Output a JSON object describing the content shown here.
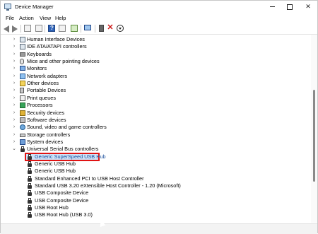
{
  "window": {
    "title": "Device Manager",
    "minimize_icon": "minimize-icon",
    "maximize_icon": "maximize-icon",
    "close_label": "✕"
  },
  "menu": {
    "items": [
      "File",
      "Action",
      "View",
      "Help"
    ]
  },
  "toolbar": {
    "icons": [
      "back-arrow-icon",
      "forward-arrow-icon",
      "show-hide-console-tree-icon",
      "properties-icon",
      "help-icon",
      "update-driver-icon",
      "scan-hardware-icon",
      "uninstall-device-icon",
      "remove-device-icon",
      "disable-device-icon"
    ],
    "remove_glyph": "✕"
  },
  "tree": {
    "categories": [
      {
        "label": "Human Interface Devices",
        "icon": "hid-icon"
      },
      {
        "label": "IDE ATA/ATAPI controllers",
        "icon": "ide-controller-icon"
      },
      {
        "label": "Keyboards",
        "icon": "keyboard-icon"
      },
      {
        "label": "Mice and other pointing devices",
        "icon": "mouse-icon"
      },
      {
        "label": "Monitors",
        "icon": "monitor-icon"
      },
      {
        "label": "Network adapters",
        "icon": "network-adapter-icon"
      },
      {
        "label": "Other devices",
        "icon": "unknown-device-icon"
      },
      {
        "label": "Portable Devices",
        "icon": "portable-device-icon"
      },
      {
        "label": "Print queues",
        "icon": "printer-icon"
      },
      {
        "label": "Processors",
        "icon": "processor-icon"
      },
      {
        "label": "Security devices",
        "icon": "security-device-icon"
      },
      {
        "label": "Software devices",
        "icon": "software-device-icon"
      },
      {
        "label": "Sound, video and game controllers",
        "icon": "sound-icon"
      },
      {
        "label": "Storage controllers",
        "icon": "storage-controller-icon"
      },
      {
        "label": "System devices",
        "icon": "system-device-icon"
      }
    ],
    "expanded_category": {
      "label": "Universal Serial Bus controllers",
      "icon": "usb-controller-icon",
      "children": [
        "Generic SuperSpeed USB Hub",
        "Generic USB Hub",
        "Generic USB Hub",
        "Standard Enhanced PCI to USB Host Controller",
        "Standard USB 3.20 eXtensible Host Controller - 1.20 (Microsoft)",
        "USB Composite Device",
        "USB Composite Device",
        "USB Root Hub",
        "USB Root Hub (USB 3.0)"
      ],
      "selected_child": "Generic SuperSpeed USB Hub"
    },
    "collapsed_glyph": "›",
    "expanded_glyph": "⌄"
  },
  "colors": {
    "selection_fill": "#cfe3f8",
    "selection_border": "#e01313",
    "selected_text": "#1a4f9c"
  }
}
